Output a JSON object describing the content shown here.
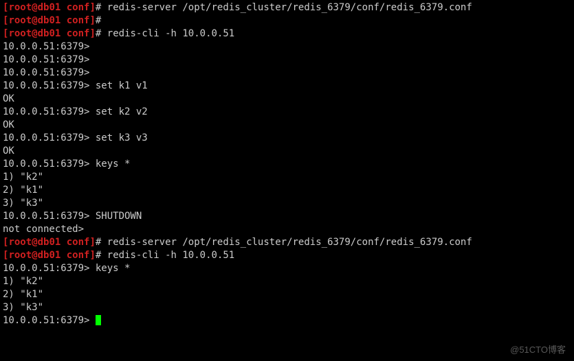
{
  "lines": [
    {
      "type": "prompt",
      "user": "root",
      "host": "db01",
      "dir": "conf",
      "command": "redis-server /opt/redis_cluster/redis_6379/conf/redis_6379.conf"
    },
    {
      "type": "prompt",
      "user": "root",
      "host": "db01",
      "dir": "conf",
      "command": ""
    },
    {
      "type": "prompt",
      "user": "root",
      "host": "db01",
      "dir": "conf",
      "command": "redis-cli -h 10.0.0.51"
    },
    {
      "type": "plain",
      "text": "10.0.0.51:6379> "
    },
    {
      "type": "plain",
      "text": "10.0.0.51:6379> "
    },
    {
      "type": "plain",
      "text": "10.0.0.51:6379> "
    },
    {
      "type": "plain",
      "text": "10.0.0.51:6379> set k1 v1"
    },
    {
      "type": "plain",
      "text": "OK"
    },
    {
      "type": "plain",
      "text": "10.0.0.51:6379> set k2 v2"
    },
    {
      "type": "plain",
      "text": "OK"
    },
    {
      "type": "plain",
      "text": "10.0.0.51:6379> set k3 v3"
    },
    {
      "type": "plain",
      "text": "OK"
    },
    {
      "type": "plain",
      "text": "10.0.0.51:6379> keys *"
    },
    {
      "type": "plain",
      "text": "1) \"k2\""
    },
    {
      "type": "plain",
      "text": "2) \"k1\""
    },
    {
      "type": "plain",
      "text": "3) \"k3\""
    },
    {
      "type": "plain",
      "text": "10.0.0.51:6379> SHUTDOWN"
    },
    {
      "type": "plain",
      "text": "not connected> "
    },
    {
      "type": "prompt",
      "user": "root",
      "host": "db01",
      "dir": "conf",
      "command": "redis-server /opt/redis_cluster/redis_6379/conf/redis_6379.conf"
    },
    {
      "type": "prompt",
      "user": "root",
      "host": "db01",
      "dir": "conf",
      "command": "redis-cli -h 10.0.0.51"
    },
    {
      "type": "plain",
      "text": "10.0.0.51:6379> keys *"
    },
    {
      "type": "plain",
      "text": "1) \"k2\""
    },
    {
      "type": "plain",
      "text": "2) \"k1\""
    },
    {
      "type": "plain",
      "text": "3) \"k3\""
    },
    {
      "type": "cursor",
      "text": "10.0.0.51:6379> "
    }
  ],
  "symbols": {
    "open_bracket": "[",
    "close_bracket": "]",
    "at": "@",
    "hash": "#",
    "space": " "
  },
  "watermark": "@51CTO博客"
}
